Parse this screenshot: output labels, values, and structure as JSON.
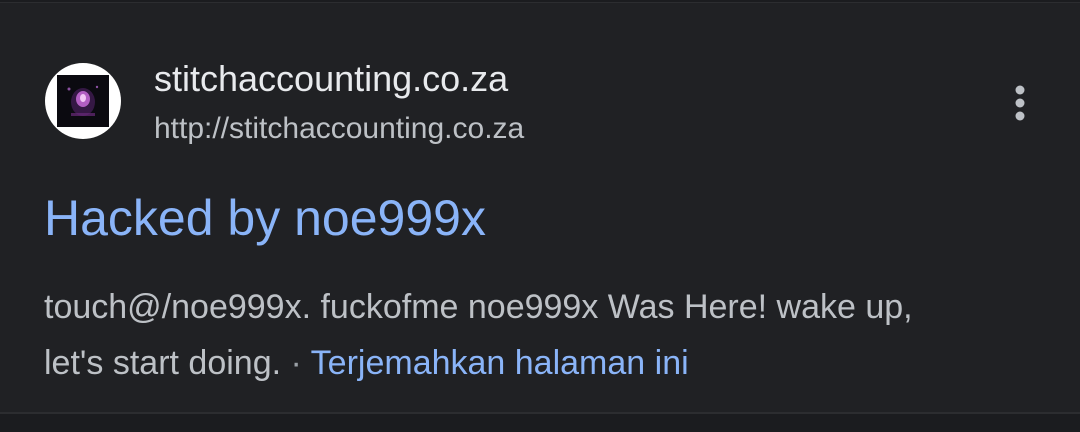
{
  "result": {
    "site_name": "stitchaccounting.co.za",
    "site_url": "http://stitchaccounting.co.za",
    "favicon_icon": "site-favicon-image",
    "menu_icon": "more-vert-icon",
    "title": "Hacked by noe999x",
    "snippet_line1": "touch@/noe999x. fuckofme noe999x Was Here! wake up,",
    "snippet_line2": "let's start doing.",
    "separator": " · ",
    "translate_link": "Terjemahkan halaman ini"
  },
  "colors": {
    "background": "#202124",
    "link": "#8ab4f8",
    "primary_text": "#e8eaed",
    "secondary_text": "#bdc1c6"
  }
}
